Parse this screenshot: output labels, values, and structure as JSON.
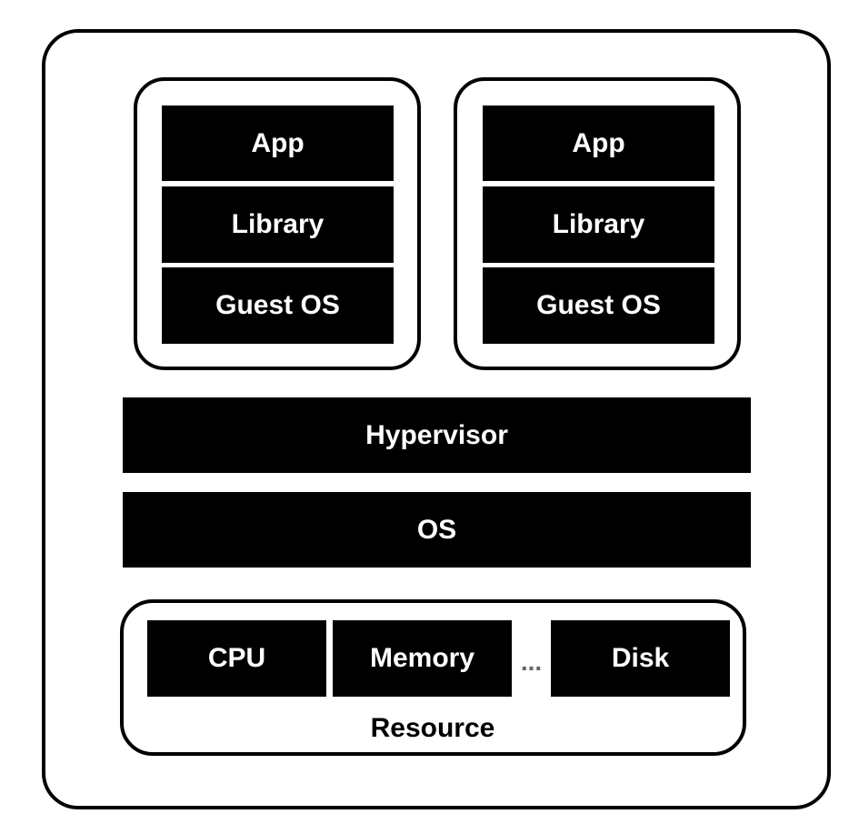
{
  "vms": [
    {
      "layers": [
        "App",
        "Library",
        "Guest OS"
      ]
    },
    {
      "layers": [
        "App",
        "Library",
        "Guest OS"
      ]
    }
  ],
  "hypervisor": "Hypervisor",
  "os": "OS",
  "resource": {
    "label": "Resource",
    "items": [
      "CPU",
      "Memory",
      "Disk"
    ],
    "ellipsis": "..."
  }
}
